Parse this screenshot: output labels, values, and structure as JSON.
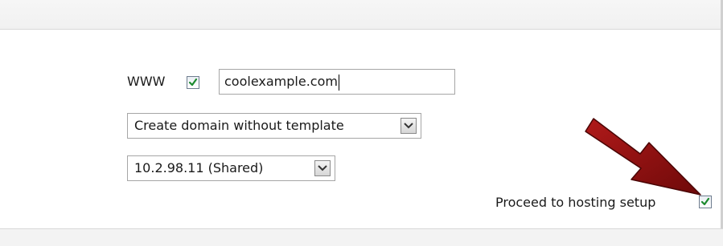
{
  "form": {
    "www_label": "WWW",
    "www_checked": true,
    "domain_value": "coolexample.com",
    "template_select": "Create domain without template",
    "ip_select": "10.2.98.11 (Shared)",
    "proceed_label": "Proceed to hosting setup",
    "proceed_checked": true
  },
  "icons": {
    "checkmark": "check-icon",
    "dropdown": "chevron-down-icon",
    "pointer": "arrow-icon"
  },
  "colors": {
    "check": "#1c8a2e",
    "arrow": "#8b1111"
  }
}
